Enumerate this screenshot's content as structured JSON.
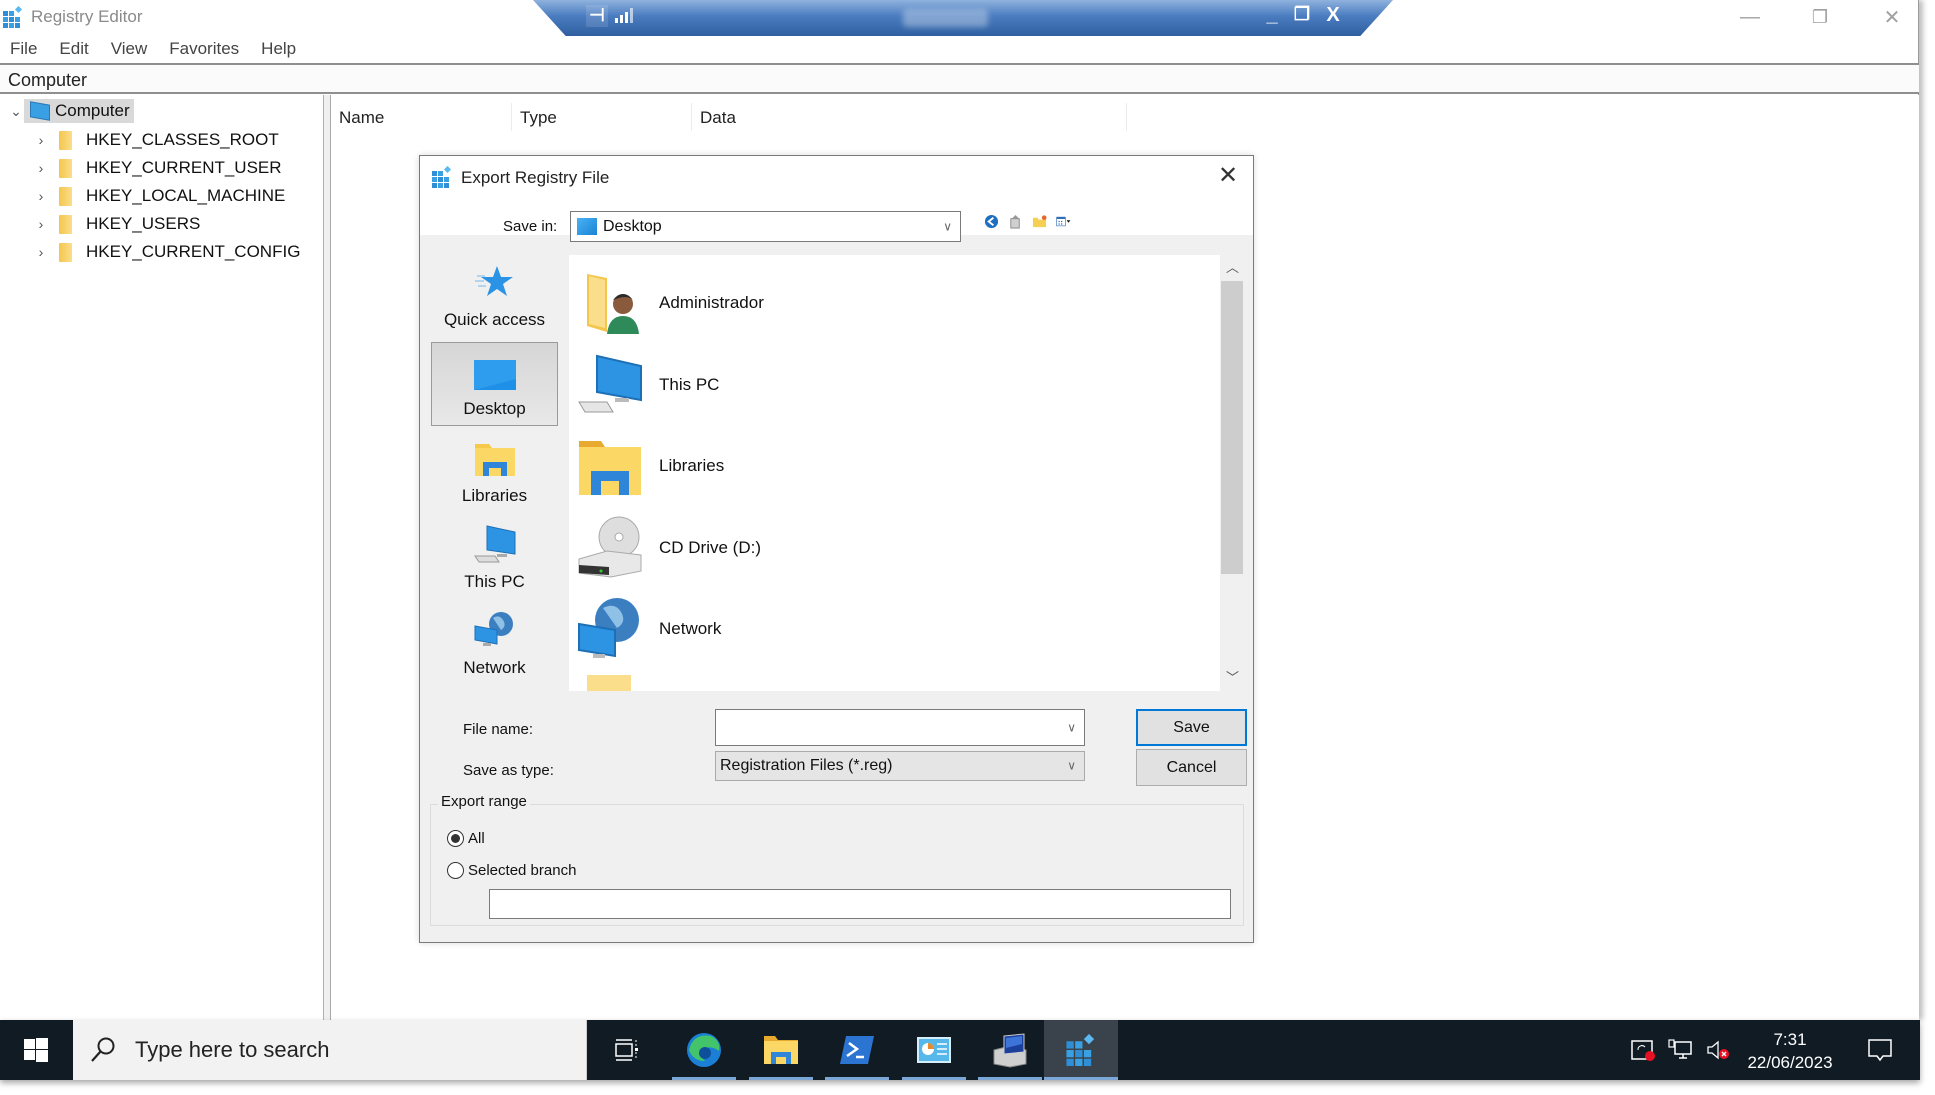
{
  "app": {
    "title": "Registry Editor",
    "menu": [
      "File",
      "Edit",
      "View",
      "Favorites",
      "Help"
    ],
    "address": "Computer",
    "window_controls": {
      "minimize": "—",
      "restore": "❐",
      "close": "✕"
    }
  },
  "tree": {
    "root": "Computer",
    "children": [
      "HKEY_CLASSES_ROOT",
      "HKEY_CURRENT_USER",
      "HKEY_LOCAL_MACHINE",
      "HKEY_USERS",
      "HKEY_CURRENT_CONFIG"
    ]
  },
  "list": {
    "columns": [
      "Name",
      "Type",
      "Data"
    ]
  },
  "dialog": {
    "title": "Export Registry File",
    "close": "✕",
    "save_in_label": "Save in:",
    "save_in_value": "Desktop",
    "toolbar_icons": [
      "back-icon",
      "up-folder-icon",
      "new-folder-icon",
      "view-menu-icon"
    ],
    "places": [
      {
        "label": "Quick access",
        "icon": "quick-access-star-icon",
        "selected": false
      },
      {
        "label": "Desktop",
        "icon": "desktop-icon",
        "selected": true
      },
      {
        "label": "Libraries",
        "icon": "libraries-icon",
        "selected": false
      },
      {
        "label": "This PC",
        "icon": "this-pc-icon",
        "selected": false
      },
      {
        "label": "Network",
        "icon": "network-icon",
        "selected": false
      }
    ],
    "files": [
      {
        "name": "Administrador",
        "icon": "user-folder-icon"
      },
      {
        "name": "This PC",
        "icon": "this-pc-icon"
      },
      {
        "name": "Libraries",
        "icon": "libraries-icon"
      },
      {
        "name": "CD Drive (D:)",
        "icon": "cd-drive-icon"
      },
      {
        "name": "Network",
        "icon": "network-icon"
      }
    ],
    "file_name_label": "File name:",
    "file_name_value": "",
    "save_as_type_label": "Save as type:",
    "save_as_type_value": "Registration Files (*.reg)",
    "save_button": "Save",
    "cancel_button": "Cancel",
    "export_range": {
      "label": "Export range",
      "options": [
        {
          "label": "All",
          "checked": true
        },
        {
          "label": "Selected branch",
          "checked": false
        }
      ],
      "branch_value": ""
    }
  },
  "rdp_bar": {
    "controls": {
      "minimize": "_",
      "restore": "❐",
      "close": "X"
    }
  },
  "taskbar": {
    "search_placeholder": "Type here to search",
    "apps": [
      "task-view",
      "edge",
      "file-explorer",
      "powershell",
      "control-panel",
      "remote-desktop-services",
      "registry-editor"
    ],
    "active_app": "registry-editor",
    "time": "7:31",
    "date": "22/06/2023"
  },
  "colors": {
    "accent": "#0078d7",
    "taskbar": "#101b24",
    "dialog_bg": "#f0f0f0"
  }
}
